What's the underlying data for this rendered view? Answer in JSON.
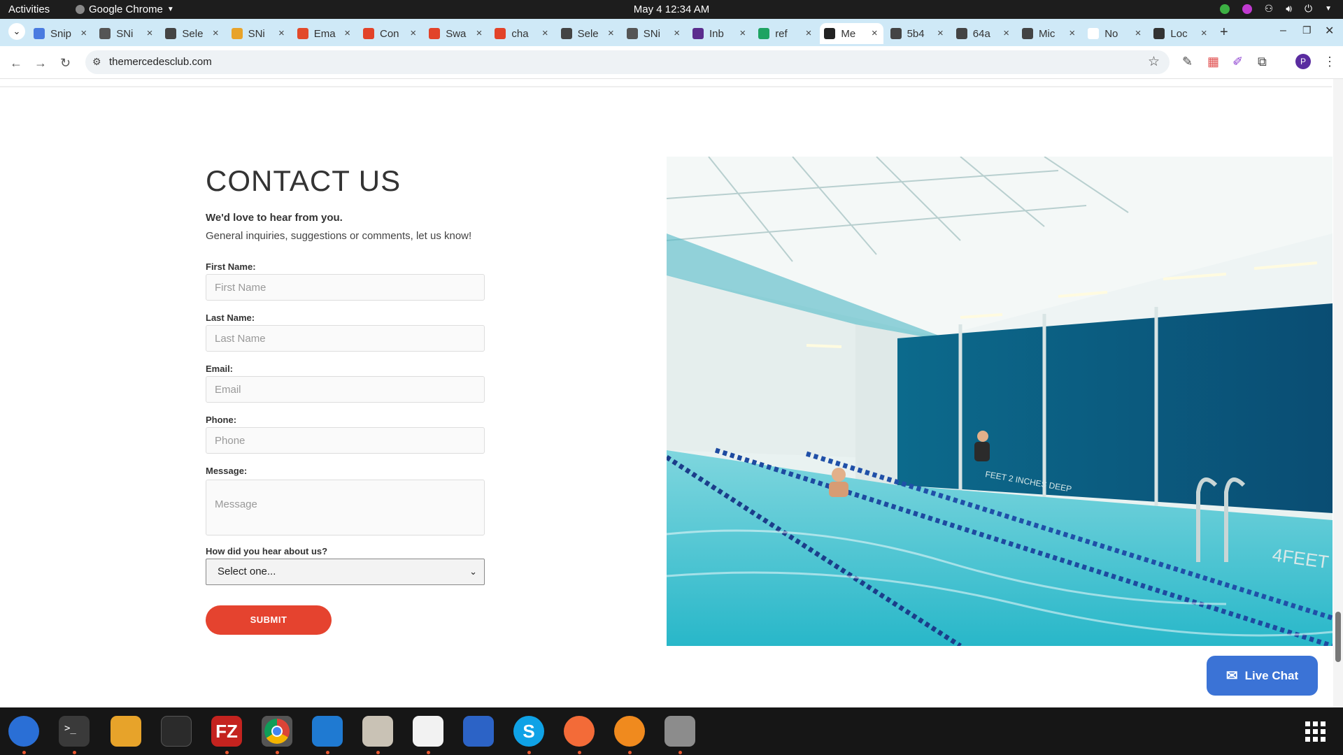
{
  "system": {
    "activities": "Activities",
    "app_name": "Google Chrome",
    "clock": "May 4  12:34 AM"
  },
  "tabs": [
    {
      "label": "Snip",
      "color": "#4a7be0"
    },
    {
      "label": "SNi",
      "color": "#555555"
    },
    {
      "label": "Sele",
      "color": "#444444"
    },
    {
      "label": "SNi",
      "color": "#e8a32a"
    },
    {
      "label": "Ema",
      "color": "#e24a2a"
    },
    {
      "label": "Con",
      "color": "#e24329"
    },
    {
      "label": "Swa",
      "color": "#e24329"
    },
    {
      "label": "cha",
      "color": "#e24329"
    },
    {
      "label": "Sele",
      "color": "#444444"
    },
    {
      "label": "SNi",
      "color": "#555555"
    },
    {
      "label": "Inb",
      "color": "#5b2d8e"
    },
    {
      "label": "ref",
      "color": "#1ea362"
    },
    {
      "label": "Me",
      "color": "#222222"
    },
    {
      "label": "5b4",
      "color": "#444444"
    },
    {
      "label": "64a",
      "color": "#444444"
    },
    {
      "label": "Mic",
      "color": "#444444"
    },
    {
      "label": "No",
      "color": "#ffffff"
    },
    {
      "label": "Loc",
      "color": "#333333"
    }
  ],
  "browser": {
    "url": "themercedesclub.com",
    "profile_initial": "P"
  },
  "page": {
    "title": "CONTACT US",
    "subtitle_bold": "We'd love to hear from you.",
    "subtitle": "General inquiries, suggestions or comments, let us know!",
    "fields": {
      "first_name": {
        "label": "First Name:",
        "placeholder": "First Name"
      },
      "last_name": {
        "label": "Last Name:",
        "placeholder": "Last Name"
      },
      "email": {
        "label": "Email:",
        "placeholder": "Email"
      },
      "phone": {
        "label": "Phone:",
        "placeholder": "Phone"
      },
      "message": {
        "label": "Message:",
        "placeholder": "Message"
      }
    },
    "hear_label": "How did you hear about us?",
    "hear_selected": "Select one...",
    "submit_label": "SUBMIT",
    "photo_text_depth": "4FEET",
    "photo_text_depth2": "FEET 2 INCHES DEEP",
    "live_chat": "Live Chat"
  },
  "colors": {
    "accent": "#e5432f",
    "live_chat": "#3b73d6",
    "tabbar": "#cfe9f7"
  }
}
